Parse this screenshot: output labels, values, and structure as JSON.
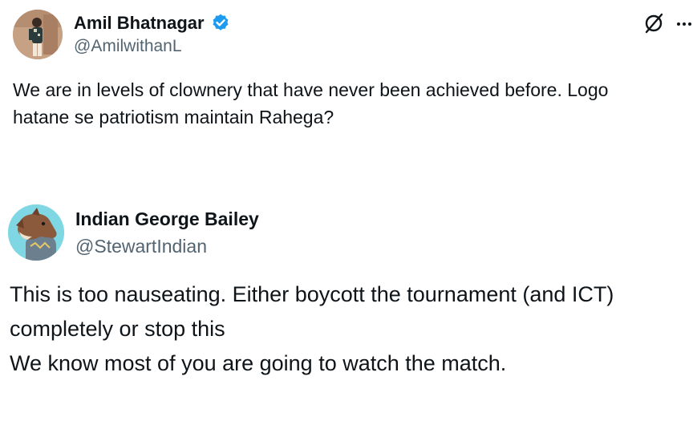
{
  "tweets": [
    {
      "author_name": "Amil Bhatnagar",
      "author_handle": "@AmilwithanL",
      "verified": true,
      "lines": [
        "We are in levels of clownery that have never been achieved before. Logo",
        "hatane se patriotism maintain Rahega?"
      ]
    },
    {
      "author_name": "Indian George Bailey",
      "author_handle": "@StewartIndian",
      "verified": false,
      "lines": [
        "This is too nauseating. Either boycott the tournament (and ICT)",
        "completely or stop this",
        "We know most of you are going to watch the match."
      ]
    }
  ],
  "icons": {
    "verified": "verified-badge-icon",
    "grok": "grok-icon",
    "more": "more-icon"
  },
  "colors": {
    "text_primary": "#0f1419",
    "text_secondary": "#536471",
    "verified_blue": "#1d9bf0",
    "avatar2_bg": "#7fd7e3"
  }
}
